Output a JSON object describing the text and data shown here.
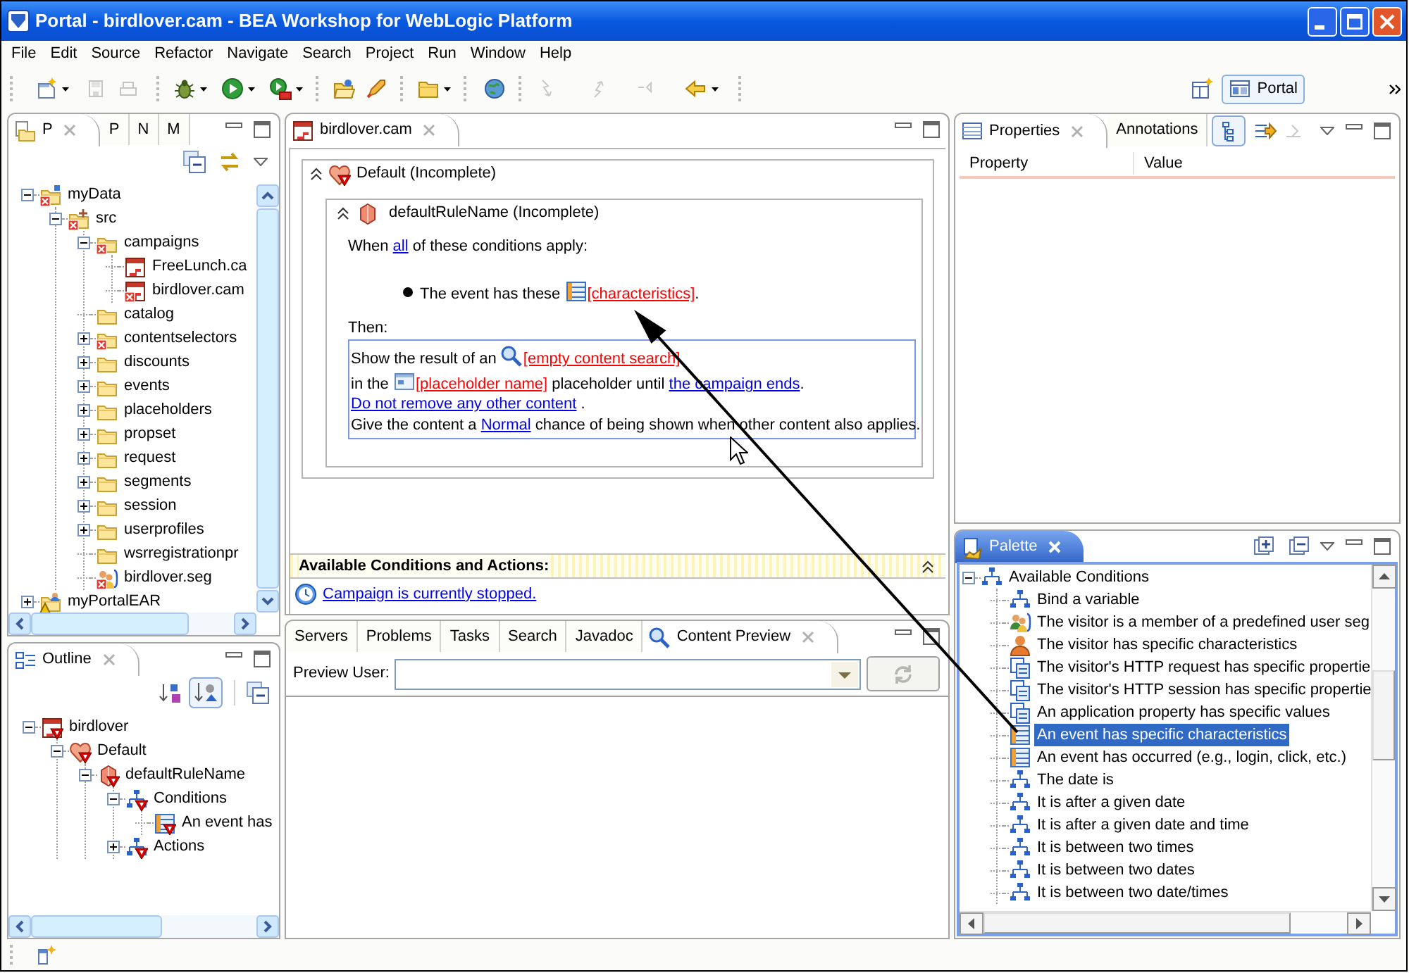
{
  "window": {
    "title": "Portal - birdlover.cam - BEA Workshop for WebLogic Platform"
  },
  "menu_bar": [
    "File",
    "Edit",
    "Source",
    "Refactor",
    "Navigate",
    "Search",
    "Project",
    "Run",
    "Window",
    "Help"
  ],
  "toolbar": {
    "perspective": "Portal"
  },
  "package_explorer": {
    "tabs": [
      {
        "label": "P",
        "selected": true
      },
      {
        "label": "P",
        "selected": false
      },
      {
        "label": "N",
        "selected": false
      },
      {
        "label": "M",
        "selected": false
      }
    ],
    "tree": [
      {
        "label": "myData",
        "kind": "project",
        "error": true,
        "warning": false,
        "expanded": true,
        "children": [
          {
            "label": "src",
            "kind": "source-folder",
            "error": true,
            "warning": false,
            "expanded": true,
            "children": [
              {
                "label": "campaigns",
                "kind": "folder",
                "error": true,
                "warning": false,
                "expanded": true,
                "children": [
                  {
                    "label": "FreeLunch.ca",
                    "kind": "campaign",
                    "error": false,
                    "warning": false
                  },
                  {
                    "label": "birdlover.cam",
                    "kind": "campaign",
                    "error": true,
                    "warning": false
                  }
                ]
              },
              {
                "label": "catalog",
                "kind": "folder",
                "error": false,
                "warning": false
              },
              {
                "label": "contentselectors",
                "kind": "folder",
                "error": true,
                "warning": false,
                "expanded": false
              },
              {
                "label": "discounts",
                "kind": "folder",
                "error": false,
                "warning": false,
                "expanded": false
              },
              {
                "label": "events",
                "kind": "folder",
                "error": false,
                "warning": false,
                "expanded": false
              },
              {
                "label": "placeholders",
                "kind": "folder",
                "error": false,
                "warning": false,
                "expanded": false
              },
              {
                "label": "propset",
                "kind": "folder",
                "error": false,
                "warning": false,
                "expanded": false
              },
              {
                "label": "request",
                "kind": "folder",
                "error": false,
                "warning": false,
                "expanded": false
              },
              {
                "label": "segments",
                "kind": "folder",
                "error": false,
                "warning": false,
                "expanded": false
              },
              {
                "label": "session",
                "kind": "folder",
                "error": false,
                "warning": false,
                "expanded": false
              },
              {
                "label": "userprofiles",
                "kind": "folder",
                "error": false,
                "warning": false,
                "expanded": false
              },
              {
                "label": "wsrregistrationpr",
                "kind": "folder",
                "error": false,
                "warning": false
              },
              {
                "label": "birdlover.seg",
                "kind": "segment",
                "error": true,
                "warning": false
              }
            ]
          }
        ]
      },
      {
        "label": "myPortalEAR",
        "kind": "ear-project",
        "error": false,
        "warning": true,
        "expanded": false
      }
    ]
  },
  "outline": {
    "tabs": [
      {
        "label": "Outline",
        "selected": true
      }
    ],
    "tree": [
      {
        "label": "birdlover",
        "kind": "campaign",
        "error": true,
        "expanded": true,
        "children": [
          {
            "label": "Default",
            "kind": "scenario",
            "error": true,
            "expanded": true,
            "children": [
              {
                "label": "defaultRuleName",
                "kind": "rule",
                "error": true,
                "expanded": true,
                "children": [
                  {
                    "label": "Conditions",
                    "kind": "group",
                    "error": true,
                    "expanded": true,
                    "children": [
                      {
                        "label": "An event has",
                        "kind": "event",
                        "error": true
                      }
                    ]
                  },
                  {
                    "label": "Actions",
                    "kind": "group",
                    "error": true,
                    "expanded": false
                  }
                ]
              }
            ]
          }
        ]
      }
    ]
  },
  "editor": {
    "tabs": [
      {
        "label": "birdlover.cam",
        "selected": true
      }
    ],
    "scenario": {
      "title": "Default (Incomplete)",
      "expanded": true,
      "rule": {
        "title": "defaultRuleName (Incomplete)",
        "expanded": true,
        "intro": [
          {
            "kind": "text",
            "text": "When "
          },
          {
            "kind": "link",
            "text": "all"
          },
          {
            "kind": "text",
            "text": " of these conditions apply:"
          }
        ],
        "conditions": [
          [
            {
              "kind": "text",
              "text": "The event has these "
            },
            {
              "kind": "event-field",
              "text": "[characteristics]"
            },
            {
              "kind": "text",
              "text": "."
            }
          ]
        ],
        "then_label": "Then:",
        "actions": [
          [
            {
              "kind": "text",
              "text": "Show the result of an "
            },
            {
              "kind": "search-field",
              "text": "[empty content search]"
            }
          ],
          [
            {
              "kind": "text",
              "text": "in the "
            },
            {
              "kind": "placeholder-field",
              "text": "[placeholder name]"
            },
            {
              "kind": "text",
              "text": " placeholder until "
            },
            {
              "kind": "link",
              "text": "the campaign ends"
            },
            {
              "kind": "text",
              "text": "."
            }
          ],
          [
            {
              "kind": "link",
              "text": "Do not remove any other content"
            },
            {
              "kind": "text",
              "text": " ."
            }
          ],
          [
            {
              "kind": "text",
              "text": "Give the content a "
            },
            {
              "kind": "link",
              "text": "Normal"
            },
            {
              "kind": "text",
              "text": " chance of being shown when other content also applies."
            }
          ]
        ]
      }
    },
    "available_header": "Available Conditions and Actions:",
    "status_link": "Campaign is currently stopped."
  },
  "bottom_panel": {
    "tabs": [
      {
        "label": "Servers",
        "selected": false
      },
      {
        "label": "Problems",
        "selected": false
      },
      {
        "label": "Tasks",
        "selected": false
      },
      {
        "label": "Search",
        "selected": false
      },
      {
        "label": "Javadoc",
        "selected": false
      },
      {
        "label": "Content Preview",
        "selected": true
      }
    ],
    "preview_user_label": "Preview User:",
    "refresh_button": {
      "disabled": true
    }
  },
  "properties": {
    "tabs": [
      {
        "label": "Properties",
        "selected": true
      },
      {
        "label": "Annotations",
        "selected": false
      }
    ],
    "columns": [
      "Property",
      "Value"
    ]
  },
  "palette": {
    "active": true,
    "tabs": [
      {
        "label": "Palette",
        "selected": true
      }
    ],
    "tree": [
      {
        "label": "Available Conditions",
        "kind": "rule",
        "selected": false,
        "expanded": true,
        "children": [
          {
            "label": "Bind a variable",
            "kind": "rule",
            "selected": false
          },
          {
            "label": "The visitor is a member of a predefined user seg",
            "kind": "segment",
            "selected": false
          },
          {
            "label": "The visitor has specific characteristics",
            "kind": "visitor",
            "selected": false
          },
          {
            "label": "The visitor's HTTP request has specific propertie",
            "kind": "request",
            "selected": false
          },
          {
            "label": "The visitor's HTTP session has specific propertie",
            "kind": "session",
            "selected": false
          },
          {
            "label": "An application property has specific values",
            "kind": "property",
            "selected": false
          },
          {
            "label": "An event has specific characteristics",
            "kind": "event",
            "selected": true
          },
          {
            "label": "An event has occurred (e.g., login, click, etc.)",
            "kind": "event",
            "selected": false
          },
          {
            "label": "The date is",
            "kind": "date",
            "selected": false
          },
          {
            "label": "It is after a given date",
            "kind": "date",
            "selected": false
          },
          {
            "label": "It is after a given date and time",
            "kind": "date",
            "selected": false
          },
          {
            "label": "It is between two times",
            "kind": "date",
            "selected": false
          },
          {
            "label": "It is between two dates",
            "kind": "date",
            "selected": false
          },
          {
            "label": "It is between two date/times",
            "kind": "date",
            "selected": false
          }
        ]
      }
    ]
  }
}
